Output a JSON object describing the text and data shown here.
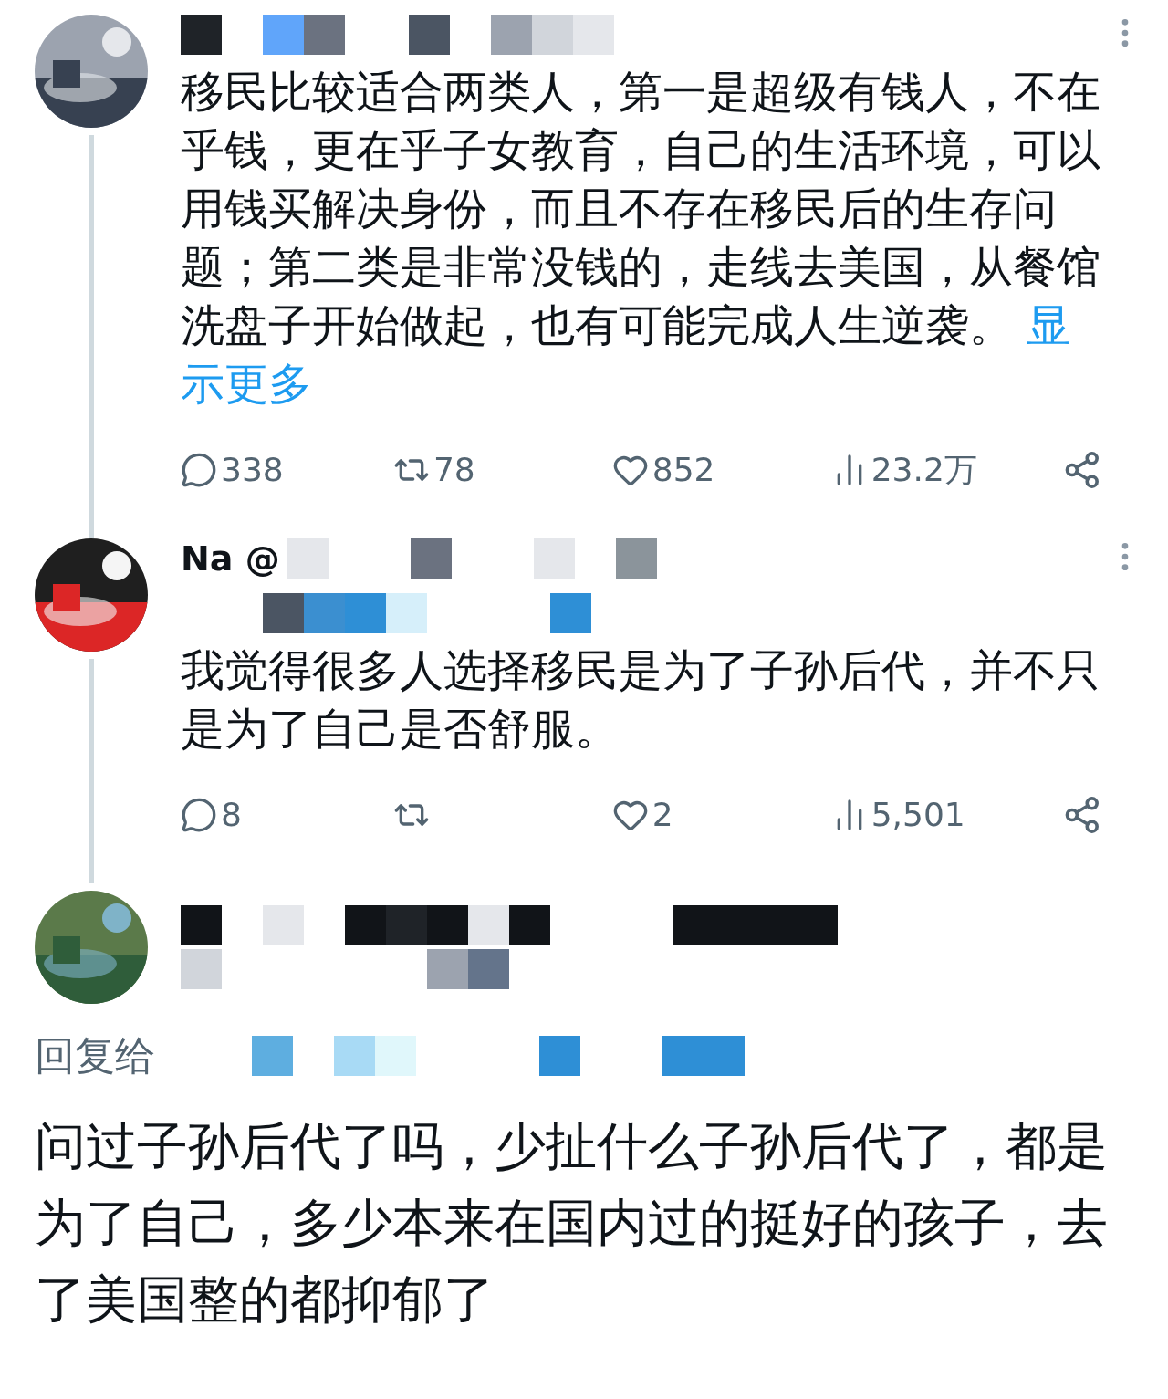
{
  "tweets": [
    {
      "kind": "thread",
      "text": "移民比较适合两类人，第一是超级有钱人，不在乎钱，更在乎子女教育，自己的生活环境，可以用钱买解决身份，而且不存在移民后的生存问题；第二类是非常没钱的，走线去美国，从餐馆洗盘子开始做起，也有可能完成人生逆袭。",
      "show_more": [
        "显",
        "示更多"
      ],
      "metrics": {
        "replies": "338",
        "retweets": "78",
        "likes": "852",
        "views": "23.2万"
      }
    },
    {
      "kind": "thread",
      "name": "Na @",
      "text": "我觉得很多人选择移民是为了子孙后代，并不只是为了自己是否舒服。",
      "metrics": {
        "replies": "8",
        "likes": "2",
        "views": "5,501"
      }
    },
    {
      "kind": "focus",
      "reply_to": "回复给",
      "text": "问过子孙后代了吗，少扯什么子孙后代了，都是为了自己，多少本来在国内过的挺好的孩子，去了美国整的都抑郁了"
    }
  ]
}
